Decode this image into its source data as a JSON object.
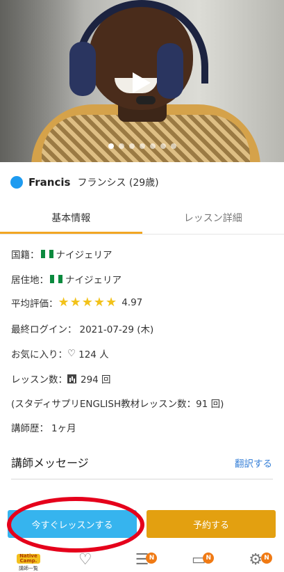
{
  "video": {
    "slide_count": 7,
    "active_slide": 0
  },
  "teacher": {
    "name_en": "Francis",
    "name_jp": "フランシス (29歳)",
    "status_color": "#1e9bf0"
  },
  "tabs": [
    {
      "label": "基本情報",
      "active": true
    },
    {
      "label": "レッスン詳細",
      "active": false
    }
  ],
  "info": {
    "nationality_label": "国籍：",
    "nationality_value": "ナイジェリア",
    "residence_label": "居住地：",
    "residence_value": "ナイジェリア",
    "rating_label": "平均評価：",
    "rating_stars": "★★★★★",
    "rating_value": "4.97",
    "last_login_label": "最終ログイン：",
    "last_login_value": "2021-07-29 (木)",
    "favorites_label": "お気に入り：",
    "favorites_icon": "♡",
    "favorites_value": "124 人",
    "lessons_label": "レッスン数：",
    "lessons_value": "294 回",
    "studysapuri_text": "(スタディサプリENGLISH教材レッスン数：91 回)",
    "experience_label": "講師歴：",
    "experience_value": "1ヶ月"
  },
  "message": {
    "title": "講師メッセージ",
    "translate_label": "翻訳する"
  },
  "buttons": {
    "lesson_now": "今すぐレッスンする",
    "book": "予約する"
  },
  "nav": {
    "logo_text": "Native Camp.",
    "home_label": "講師一覧",
    "badge": "N"
  },
  "colors": {
    "accent_tab": "#f2a623",
    "lesson_now": "#36b4ee",
    "book": "#e3a010",
    "link": "#3a82d8",
    "highlight": "#e5001b",
    "badge": "#f07a14"
  }
}
